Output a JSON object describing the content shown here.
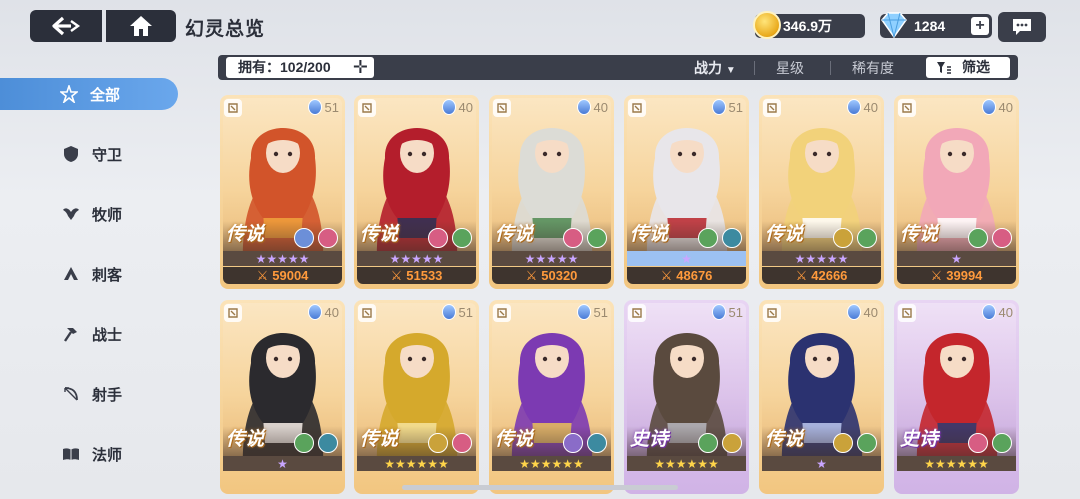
{
  "header": {
    "title": "幻灵总览",
    "gold_amount": "346.9万",
    "gem_amount": "1284",
    "plus_label": "+"
  },
  "filterbar": {
    "owned_label": "拥有：102/200",
    "sort_power": "战力",
    "sort_star": "星级",
    "sort_rarity": "稀有度",
    "filter_label": "筛选"
  },
  "sidebar": {
    "items": [
      {
        "label": "全部",
        "icon": "all-star-icon",
        "active": true
      },
      {
        "label": "守卫",
        "icon": "shield-icon"
      },
      {
        "label": "牧师",
        "icon": "wings-icon"
      },
      {
        "label": "刺客",
        "icon": "hood-icon"
      },
      {
        "label": "战士",
        "icon": "axe-icon"
      },
      {
        "label": "射手",
        "icon": "bow-icon"
      },
      {
        "label": "法师",
        "icon": "book-icon"
      }
    ]
  },
  "cards": [
    {
      "rank": "传说",
      "level": "51",
      "power": "59004",
      "stars": 5,
      "star_style": "purple",
      "frame": "gold",
      "palette": [
        "#d2542a",
        "#f0a13c"
      ],
      "elements": [
        "#6c8fd8",
        "#d75d83"
      ]
    },
    {
      "rank": "传说",
      "level": "40",
      "power": "51533",
      "stars": 5,
      "star_style": "purple",
      "frame": "gold",
      "palette": [
        "#b41e2c",
        "#2a2f55"
      ],
      "elements": [
        "#d75d83",
        "#5aa35c"
      ]
    },
    {
      "rank": "传说",
      "level": "40",
      "power": "50320",
      "stars": 5,
      "star_style": "purple",
      "frame": "gold",
      "palette": [
        "#dcdcd6",
        "#4f8a52"
      ],
      "elements": [
        "#d75d83",
        "#5aa35c"
      ]
    },
    {
      "rank": "传说",
      "level": "51",
      "power": "48676",
      "stars": 1,
      "star_style": "blue",
      "frame": "gold",
      "palette": [
        "#e8e6ea",
        "#b9242c"
      ],
      "elements": [
        "#5aa35c",
        "#3c8aa0"
      ]
    },
    {
      "rank": "传说",
      "level": "40",
      "power": "42666",
      "stars": 5,
      "star_style": "purple",
      "frame": "gold",
      "palette": [
        "#f2d27a",
        "#ffffff"
      ],
      "elements": [
        "#caa23a",
        "#5aa35c"
      ]
    },
    {
      "rank": "传说",
      "level": "40",
      "power": "39994",
      "stars": 1,
      "star_style": "purple",
      "frame": "gold",
      "palette": [
        "#f2a8b8",
        "#ffffff"
      ],
      "elements": [
        "#5aa35c",
        "#d75d83"
      ]
    },
    {
      "rank": "传说",
      "level": "40",
      "stars": 1,
      "star_style": "purple",
      "frame": "gold",
      "palette": [
        "#2b2a2e",
        "#f4ece6"
      ],
      "elements": [
        "#5aa35c",
        "#3c8aa0"
      ]
    },
    {
      "rank": "传说",
      "level": "51",
      "stars": 6,
      "star_style": "gold",
      "frame": "gold",
      "palette": [
        "#d5a92c",
        "#f6e29a"
      ],
      "elements": [
        "#caa23a",
        "#d75d83"
      ]
    },
    {
      "rank": "传说",
      "level": "51",
      "stars": 6,
      "star_style": "gold",
      "frame": "gold",
      "palette": [
        "#7c3ab2",
        "#e6c05a"
      ],
      "elements": [
        "#8a6cc8",
        "#3c8aa0"
      ]
    },
    {
      "rank": "史诗",
      "level": "51",
      "stars": 6,
      "star_style": "gold",
      "frame": "purple",
      "palette": [
        "#5a4a3e",
        "#b7b7bd"
      ],
      "elements": [
        "#5aa35c",
        "#caa23a"
      ]
    },
    {
      "rank": "传说",
      "level": "40",
      "stars": 1,
      "star_style": "purple",
      "frame": "gold",
      "palette": [
        "#2b3270",
        "#b8c6ee"
      ],
      "elements": [
        "#caa23a",
        "#5aa35c"
      ]
    },
    {
      "rank": "史诗",
      "level": "40",
      "stars": 6,
      "star_style": "gold",
      "frame": "purple",
      "palette": [
        "#c4262c",
        "#2b3a70"
      ],
      "elements": [
        "#d75d83",
        "#5aa35c"
      ]
    }
  ]
}
